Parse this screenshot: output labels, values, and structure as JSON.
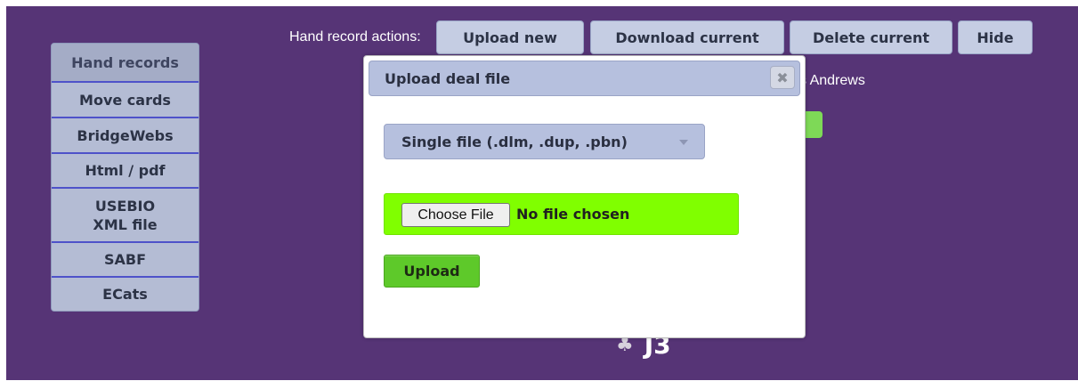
{
  "toolbar": {
    "actions_label": "Hand record actions:",
    "upload_new": "Upload new",
    "download_current": "Download current",
    "delete_current": "Delete current",
    "hide": "Hide"
  },
  "sidebar": {
    "items": [
      {
        "label": "Hand records",
        "active": true
      },
      {
        "label": "Move cards"
      },
      {
        "label": "BridgeWebs"
      },
      {
        "label": "Html / pdf"
      },
      {
        "label": "USEBIO XML file"
      },
      {
        "label": "SABF"
      },
      {
        "label": "ECats"
      }
    ]
  },
  "background": {
    "partial_name": "s Andrews",
    "card_suit_icon": "club-icon",
    "card_text": "J3"
  },
  "dialog": {
    "title": "Upload deal file",
    "close_icon": "close-icon",
    "file_type_selected": "Single file (.dlm, .dup, .pbn)",
    "choose_file_label": "Choose File",
    "file_status": "No file chosen",
    "upload_label": "Upload"
  },
  "colors": {
    "page_background": "#563476",
    "button_fill": "#c5cde3",
    "file_row_green": "#80ff00",
    "upload_green": "#5ec92a"
  }
}
